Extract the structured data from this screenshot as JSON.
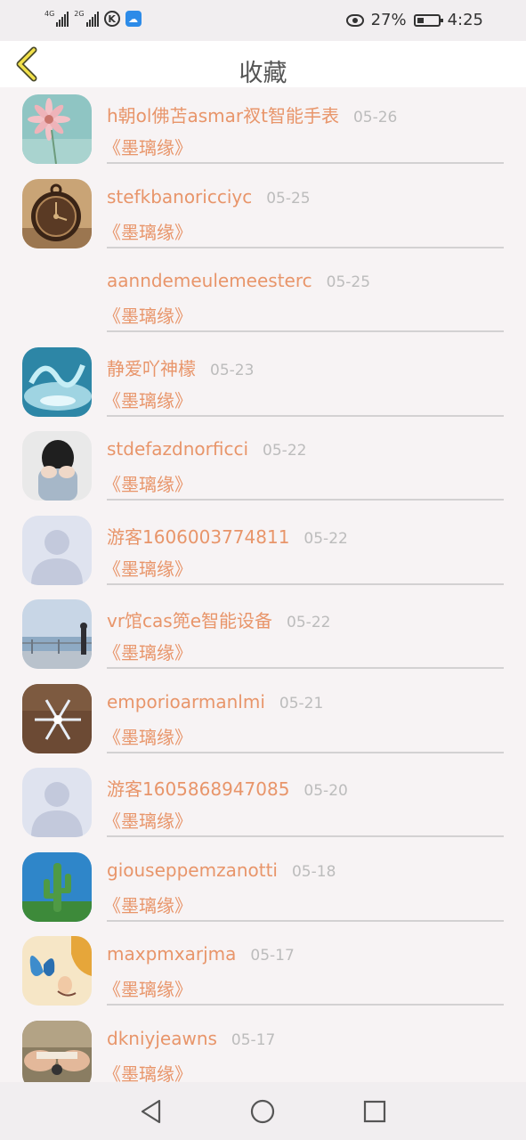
{
  "status_bar": {
    "net1": "4G",
    "net2": "2G",
    "k_label": "K",
    "battery": "27%",
    "time": "4:25"
  },
  "header": {
    "title": "收藏",
    "back_icon": "chevron-left-icon"
  },
  "items": [
    {
      "name": "h朝ol佛苫asmar衩t智能手表",
      "date": "05-26",
      "book": "《墨璃缘》",
      "avatar": "flower"
    },
    {
      "name": "stefkbanoricciyc",
      "date": "05-25",
      "book": "《墨璃缘》",
      "avatar": "pocket-watch"
    },
    {
      "name": "aanndemeulemeesterc",
      "date": "05-25",
      "book": "《墨璃缘》",
      "avatar": "none"
    },
    {
      "name": "静爱吖神檬",
      "date": "05-23",
      "book": "《墨璃缘》",
      "avatar": "water"
    },
    {
      "name": "stdefazdnorficci",
      "date": "05-22",
      "book": "《墨璃缘》",
      "avatar": "person-crying"
    },
    {
      "name": "游客1606003774811",
      "date": "05-22",
      "book": "《墨璃缘》",
      "avatar": "default"
    },
    {
      "name": "vr馆cas篼e智能设备",
      "date": "05-22",
      "book": "《墨璃缘》",
      "avatar": "seaside"
    },
    {
      "name": "emporioarmanlmi",
      "date": "05-21",
      "book": "《墨璃缘》",
      "avatar": "snowflake"
    },
    {
      "name": "游客1605868947085",
      "date": "05-20",
      "book": "《墨璃缘》",
      "avatar": "default"
    },
    {
      "name": "giouseppemzanotti",
      "date": "05-18",
      "book": "《墨璃缘》",
      "avatar": "cactus"
    },
    {
      "name": "maxpmxarjma",
      "date": "05-17",
      "book": "《墨璃缘》",
      "avatar": "butterfly"
    },
    {
      "name": "dkniyjeawns",
      "date": "05-17",
      "book": "《墨璃缘》",
      "avatar": "hands"
    }
  ],
  "nav_bar": {
    "back": "triangle-back-icon",
    "home": "circle-home-icon",
    "recents": "square-recents-icon"
  },
  "colors": {
    "accent": "#e8956a",
    "date": "#bcbcbc",
    "background": "#f7f3f4"
  }
}
